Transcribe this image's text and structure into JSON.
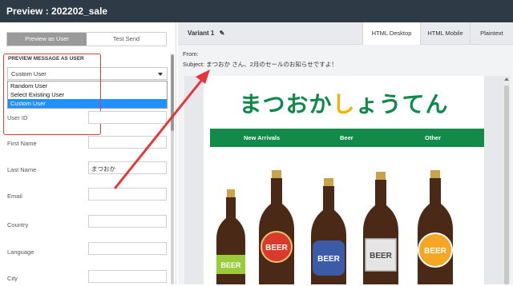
{
  "title": "Preview : 202202_sale",
  "left_panel": {
    "tabs": [
      {
        "label": "Preview as User",
        "active": true
      },
      {
        "label": "Test Send",
        "active": false
      }
    ],
    "section_label": "PREVIEW MESSAGE AS USER",
    "select_value": "Custom User",
    "dropdown_options": [
      {
        "label": "Random User",
        "selected": false
      },
      {
        "label": "Select Existing User",
        "selected": false
      },
      {
        "label": "Custom User",
        "selected": true
      }
    ],
    "fields": [
      {
        "label": "User ID",
        "value": ""
      },
      {
        "label": "First Name",
        "value": ""
      },
      {
        "label": "Last Name",
        "value": "まつおか"
      },
      {
        "label": "Email",
        "value": ""
      },
      {
        "label": "Country",
        "value": ""
      },
      {
        "label": "Language",
        "value": ""
      },
      {
        "label": "City",
        "value": ""
      }
    ]
  },
  "right_panel": {
    "variant": "Variant 1",
    "tabs": [
      {
        "label": "HTML Desktop",
        "active": true
      },
      {
        "label": "HTML Mobile",
        "active": false
      },
      {
        "label": "Plaintext",
        "active": false
      }
    ],
    "from_label": "From:",
    "subject": "Subject: まつおか さん、2月のセールのお知らせですよ！",
    "email": {
      "brand_left": "まつおか",
      "brand_accent": "し",
      "brand_right": "ょうてん",
      "nav": [
        "New Arrivals",
        "Beer",
        "Other"
      ],
      "beer_labels": [
        "BEER",
        "BEER",
        "BEER",
        "BEER",
        "BEER"
      ]
    }
  },
  "colors": {
    "titlebar": "#2e3a46",
    "brand_green": "#0d8a4a",
    "brand_yellow": "#f2b200",
    "highlight_red": "#e23b3b",
    "selection_blue": "#1e90ff"
  }
}
